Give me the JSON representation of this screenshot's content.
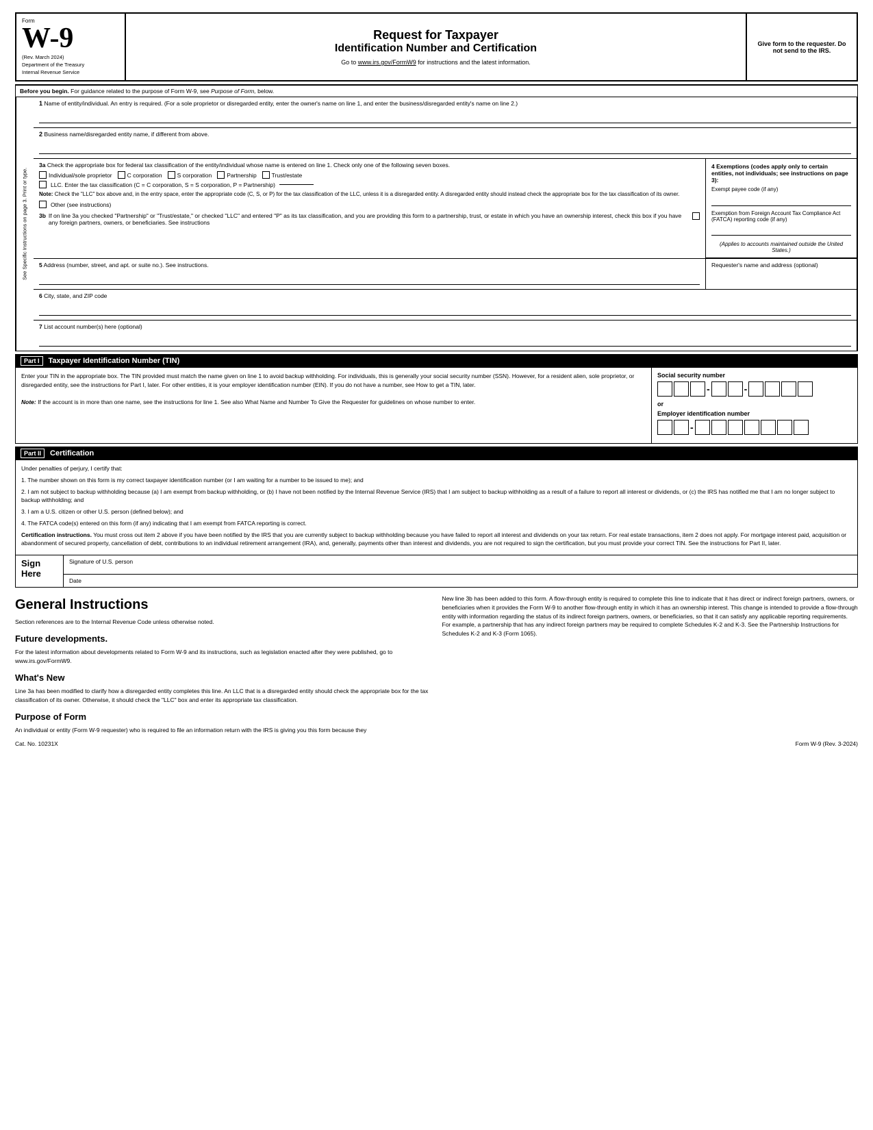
{
  "header": {
    "form_label": "Form",
    "w9": "W-9",
    "rev_date": "(Rev. March 2024)",
    "dept1": "Department of the Treasury",
    "dept2": "Internal Revenue Service",
    "title1": "Request for Taxpayer",
    "title2": "Identification Number and Certification",
    "subtitle": "Go to www.irs.gov/FormW9 for instructions and the latest information.",
    "right_text": "Give form to the requester. Do not send to the IRS."
  },
  "before_begin": {
    "label": "Before you begin.",
    "text": "For guidance related to the purpose of Form W-9, see Purpose of Form, below."
  },
  "fields": {
    "f1_label": "1",
    "f1_text": "Name of entity/individual. An entry is required. (For a sole proprietor or disregarded entity, enter the owner's name on line 1, and enter the business/disregarded entity's name on line 2.)",
    "f2_label": "2",
    "f2_text": "Business name/disregarded entity name, if different from above.",
    "f3a_label": "3a",
    "f3a_intro": "Check the appropriate box for federal tax classification of the entity/individual whose name is entered on line 1. Check only one of the following seven boxes.",
    "cb_individual": "Individual/sole proprietor",
    "cb_ccorp": "C corporation",
    "cb_scorp": "S corporation",
    "cb_partnership": "Partnership",
    "cb_trust": "Trust/estate",
    "cb_llc": "LLC. Enter the tax classification (C = C corporation, S = S corporation, P = Partnership)",
    "note_label": "Note:",
    "note_text": "Check the \"LLC\" box above and, in the entry space, enter the appropriate code (C, S, or P) for the tax classification of the LLC, unless it is a disregarded entity. A disregarded entity should instead check the appropriate box for the tax classification of its owner.",
    "cb_other": "Other (see instructions)",
    "f3b_label": "3b",
    "f3b_text": "If on line 3a you checked \"Partnership\" or \"Trust/estate,\" or checked \"LLC\" and entered \"P\" as its tax classification, and you are providing this form to a partnership, trust, or estate in which you have an ownership interest, check this box if you have any foreign partners, owners, or beneficiaries. See instructions",
    "f4_label": "4",
    "f4_title": "Exemptions (codes apply only to certain entities, not individuals; see instructions on page 3):",
    "exempt_payee": "Exempt payee code (if any)",
    "exempt_fatca_title": "Exemption from Foreign Account Tax Compliance Act (FATCA) reporting code (if any)",
    "applies_text": "(Applies to accounts maintained outside the United States.)",
    "f5_label": "5",
    "f5_text": "Address (number, street, and apt. or suite no.). See instructions.",
    "requester_text": "Requester's name and address (optional)",
    "f6_label": "6",
    "f6_text": "City, state, and ZIP code",
    "f7_label": "7",
    "f7_text": "List account number(s) here (optional)"
  },
  "sidebar_text": "See Specific Instructions on page 3.     Print or type.",
  "part1": {
    "label": "Part I",
    "title": "Taxpayer Identification Number (TIN)"
  },
  "tin_section": {
    "intro": "Enter your TIN in the appropriate box. The TIN provided must match the name given on line 1 to avoid backup withholding. For individuals, this is generally your social security number (SSN). However, for a resident alien, sole proprietor, or disregarded entity, see the instructions for Part I, later. For other entities, it is your employer identification number (EIN). If you do not have a number, see How to get a TIN, later.",
    "note_label": "Note:",
    "note_text": "If the account is in more than one name, see the instructions for line 1. See also What Name and Number To Give the Requester for guidelines on whose number to enter.",
    "ssn_label": "Social security number",
    "or_text": "or",
    "ein_label": "Employer identification number"
  },
  "part2": {
    "label": "Part II",
    "title": "Certification"
  },
  "certification": {
    "intro": "Under penalties of perjury, I certify that:",
    "item1": "1. The number shown on this form is my correct taxpayer identification number (or I am waiting for a number to be issued to me); and",
    "item2": "2. I am not subject to backup withholding because (a) I am exempt from backup withholding, or (b) I have not been notified by the Internal Revenue Service (IRS) that I am subject to backup withholding as a result of a failure to report all interest or dividends, or (c) the IRS has notified me that I am no longer subject to backup withholding; and",
    "item3": "3. I am a U.S. citizen or other U.S. person (defined below); and",
    "item4": "4. The FATCA code(s) entered on this form (if any) indicating that I am exempt from FATCA reporting is correct.",
    "cert_instructions_label": "Certification instructions.",
    "cert_instructions_text": "You must cross out item 2 above if you have been notified by the IRS that you are currently subject to backup withholding because you have failed to report all interest and dividends on your tax return. For real estate transactions, item 2 does not apply. For mortgage interest paid, acquisition or abandonment of secured property, cancellation of debt, contributions to an individual retirement arrangement (IRA), and, generally, payments other than interest and dividends, you are not required to sign the certification, but you must provide your correct TIN. See the instructions for Part II, later."
  },
  "sign_here": {
    "label": "Sign Here",
    "sig_label": "Signature of U.S. person",
    "date_label": "Date"
  },
  "general_instructions": {
    "title": "General Instructions",
    "section_ref": "Section references are to the Internal Revenue Code unless otherwise noted.",
    "future_dev_label": "Future developments.",
    "future_dev_text": "For the latest information about developments related to Form W-9 and its instructions, such as legislation enacted after they were published, go to www.irs.gov/FormW9.",
    "whats_new_title": "What's New",
    "whats_new_text": "Line 3a has been modified to clarify how a disregarded entity completes this line. An LLC that is a disregarded entity should check the appropriate box for the tax classification of its owner. Otherwise, it should check the \"LLC\" box and enter its appropriate tax classification.",
    "purpose_title": "Purpose of Form",
    "purpose_text": "An individual or entity (Form W-9 requester) who is required to file an information return with the IRS is giving you this form because they",
    "right_col_text": "New line 3b has been added to this form. A flow-through entity is required to complete this line to indicate that it has direct or indirect foreign partners, owners, or beneficiaries when it provides the Form W-9 to another flow-through entity in which it has an ownership interest. This change is intended to provide a flow-through entity with information regarding the status of its indirect foreign partners, owners, or beneficiaries, so that it can satisfy any applicable reporting requirements. For example, a partnership that has any indirect foreign partners may be required to complete Schedules K-2 and K-3. See the Partnership Instructions for Schedules K-2 and K-3 (Form 1065)."
  },
  "footer": {
    "cat_no": "Cat. No. 10231X",
    "form_ref": "Form W-9 (Rev. 3-2024)"
  }
}
